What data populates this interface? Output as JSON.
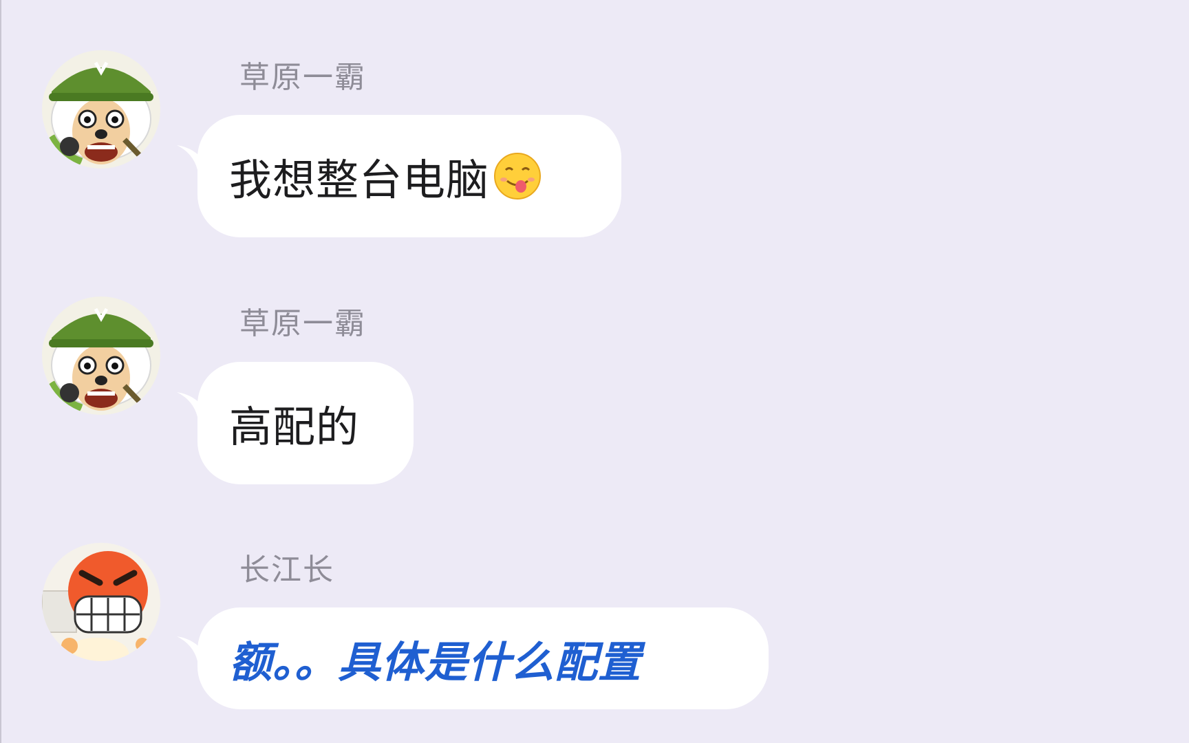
{
  "chat": {
    "messages": [
      {
        "sender": "草原一霸",
        "text": "我想整台电脑",
        "emoji": "tongue-out-emoji",
        "avatar": "green-helmet-sheep-avatar"
      },
      {
        "sender": "草原一霸",
        "text": "高配的",
        "avatar": "green-helmet-sheep-avatar"
      },
      {
        "sender": "长江长",
        "text": "额。。具体是什么配置",
        "text_color": "#1f5fd1",
        "avatar": "angry-red-face-avatar"
      }
    ]
  },
  "colors": {
    "background": "#edeaf6",
    "bubble": "#ffffff",
    "sender_text": "#8e8c97",
    "highlight_text": "#1f5fd1"
  }
}
